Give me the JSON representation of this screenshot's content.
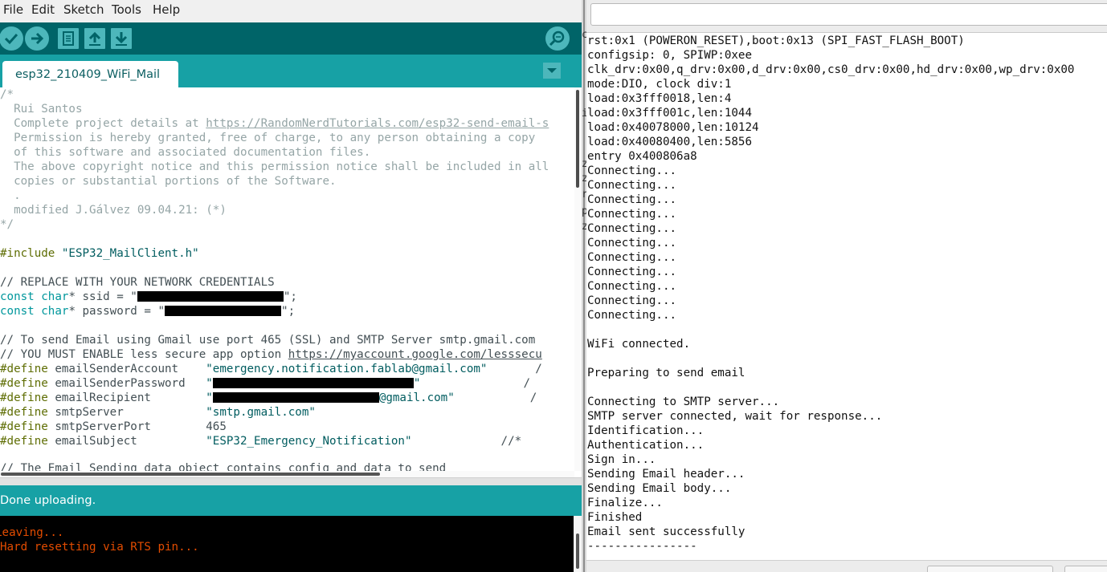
{
  "menu": {
    "items": [
      "File",
      "Edit",
      "Sketch",
      "Tools",
      "Help"
    ]
  },
  "toolbar": {
    "buttons": [
      "verify-icon",
      "upload-icon",
      "new-icon",
      "open-icon",
      "save-icon",
      "serial-monitor-icon"
    ]
  },
  "tabs": {
    "active": "esp32_210409_WiFi_Mail"
  },
  "editor": {
    "l01": "/*",
    "l02": "  Rui Santos",
    "l03a": "  Complete project details at ",
    "l03b": "https://RandomNerdTutorials.com/esp32-send-email-s",
    "l04": "  Permission is hereby granted, free of charge, to any person obtaining a copy",
    "l05": "  of this software and associated documentation files.",
    "l06": "  The above copyright notice and this permission notice shall be included in all",
    "l07": "  copies or substantial portions of the Software.",
    "l08": "  .",
    "l09": "  modified J.Gálvez 09.04.21: (*)",
    "l10": "*/",
    "l12a": "#include",
    "l12b": " \"ESP32_MailClient.h\"",
    "l14": "// REPLACE WITH YOUR NETWORK CREDENTIALS",
    "l15a": "const",
    "l15b": " ",
    "l15c": "char",
    "l15d": "* ssid = \"",
    "l15e": "\";",
    "l16a": "const",
    "l16b": " ",
    "l16c": "char",
    "l16d": "* password = \"",
    "l16e": "\";",
    "l18": "// To send Email using Gmail use port 465 (SSL) and SMTP Server smtp.gmail.com",
    "l19a": "// YOU MUST ENABLE less secure app option ",
    "l19b": "https://myaccount.google.com/lesssecu",
    "def": "#define",
    "l20a": " emailSenderAccount    ",
    "l20b": "\"emergency.notification.fablab@gmail.com\"",
    "l20c": "       /",
    "l21a": " emailSenderPassword   ",
    "l21b": "\"",
    "l21c": "\"",
    "l21d": "               /",
    "l22a": " emailRecipient        ",
    "l22b": "\"",
    "l22c": "@gmail.com\"",
    "l22d": "           /",
    "l23a": " smtpServer            ",
    "l23b": "\"smtp.gmail.com\"",
    "l24a": " smtpServerPort        ",
    "l24b": "465",
    "l25a": " emailSubject          ",
    "l25b": "\"ESP32_Emergency_Notification\"",
    "l25c": "             //*",
    "l27": "// The Email Sending data object contains config and data to send"
  },
  "status": {
    "message": "Done uploading."
  },
  "console": {
    "line1": "Leaving...",
    "line2": "Hard resetting via RTS pin..."
  },
  "serial": {
    "input_value": "",
    "lines": [
      "rst:0x1 (POWERON_RESET),boot:0x13 (SPI_FAST_FLASH_BOOT)",
      "configsip: 0, SPIWP:0xee",
      "clk_drv:0x00,q_drv:0x00,d_drv:0x00,cs0_drv:0x00,hd_drv:0x00,wp_drv:0x00",
      "mode:DIO, clock div:1",
      "load:0x3fff0018,len:4",
      "load:0x3fff001c,len:1044",
      "load:0x40078000,len:10124",
      "load:0x40080400,len:5856",
      "entry 0x400806a8",
      "Connecting...",
      "Connecting...",
      "Connecting...",
      "Connecting...",
      "Connecting...",
      "Connecting...",
      "Connecting...",
      "Connecting...",
      "Connecting...",
      "Connecting...",
      "Connecting...",
      "",
      "WiFi connected.",
      "",
      "Preparing to send email",
      "",
      "Connecting to SMTP server...",
      "SMTP server connected, wait for response...",
      "Identification...",
      "Authentication...",
      "Sign in...",
      "Sending Email header...",
      "Sending Email body...",
      "Finalize...",
      "Finished",
      "Email sent successfully",
      "----------------"
    ]
  },
  "background_window": {
    "fragments": [
      "c",
      "i",
      "z",
      "z",
      "r",
      "p",
      "z"
    ]
  },
  "colors": {
    "toolbar": "#006468",
    "tabstrip": "#17a1a5",
    "button": "#4db7bb",
    "comment": "#95a5a6",
    "keyword": "#00979c",
    "preprocessor": "#5e6d03",
    "string": "#005c5f",
    "console_text": "#e34c00"
  }
}
